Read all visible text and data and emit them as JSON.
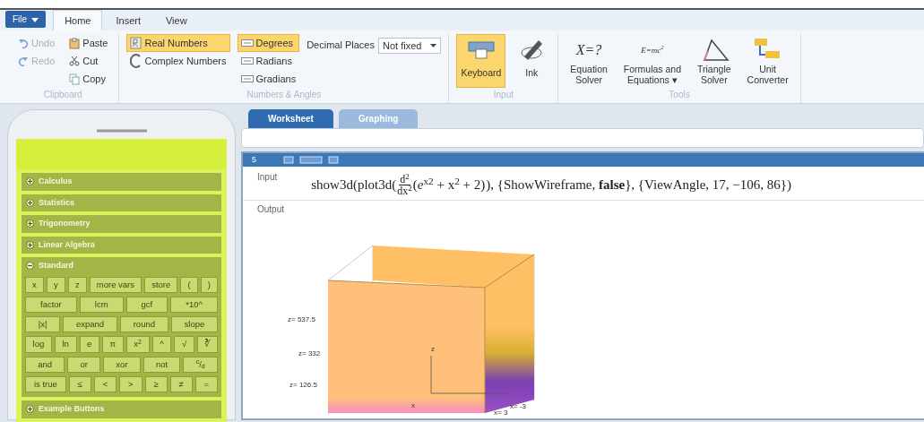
{
  "ribbon": {
    "file_button": "File",
    "tabs": [
      {
        "label": "Home",
        "selected": true
      },
      {
        "label": "Insert",
        "selected": false
      },
      {
        "label": "View",
        "selected": false
      }
    ],
    "groups": [
      {
        "kind": "clipboard",
        "label": "Clipboard",
        "items": [
          {
            "label": "Undo",
            "disabled": true
          },
          {
            "label": "Redo",
            "disabled": true
          },
          {
            "label": "Paste",
            "disabled": false
          },
          {
            "label": "Cut",
            "disabled": false
          },
          {
            "label": "Copy",
            "disabled": false
          }
        ]
      },
      {
        "kind": "numbers",
        "label": "Numbers & Angles",
        "number_modes": [
          {
            "label": "Real Numbers",
            "selected": true
          },
          {
            "label": "Complex Numbers",
            "selected": false
          }
        ],
        "angle_modes": [
          {
            "label": "Degrees",
            "selected": true
          },
          {
            "label": "Radians",
            "selected": false
          },
          {
            "label": "Gradians",
            "selected": false
          }
        ],
        "decimal_label": "Decimal Places",
        "decimal_value": "Not fixed"
      },
      {
        "kind": "input",
        "label": "Input",
        "items": [
          {
            "label": "Keyboard",
            "selected": true
          },
          {
            "label": "Ink",
            "selected": false
          }
        ]
      },
      {
        "kind": "tools",
        "label": "Tools",
        "items": [
          {
            "symbol": "X=?",
            "label": "Equation Solver"
          },
          {
            "symbol": "E=mc$^{2}$",
            "label": "Formulas and Equations ▾"
          },
          {
            "label": "Triangle Solver"
          },
          {
            "label": "Unit Converter"
          }
        ]
      }
    ]
  },
  "keypad": {
    "sections": [
      {
        "label": "Calculus",
        "expanded": false
      },
      {
        "label": "Statistics",
        "expanded": false
      },
      {
        "label": "Trigonometry",
        "expanded": false
      },
      {
        "label": "Linear Algebra",
        "expanded": false
      },
      {
        "label": "Standard",
        "expanded": true,
        "rows": [
          [
            "x",
            "y",
            "z",
            "more vars",
            "store",
            "(",
            ")"
          ],
          [
            "factor",
            "lcm",
            "gcf",
            "*10^"
          ],
          [
            "|x|",
            "expand",
            "round",
            "slope"
          ],
          [
            "log",
            "ln",
            "e",
            "π",
            "x$^{2}$",
            "^",
            "√",
            "∛"
          ],
          [
            "and",
            "or",
            "xor",
            "not",
            "$^{c}$/$_{d}$"
          ],
          [
            "is true",
            "≤",
            "<",
            ">",
            "≥",
            "≠",
            "="
          ]
        ]
      },
      {
        "label": "Example Buttons",
        "expanded": false
      }
    ]
  },
  "worksheet": {
    "tabs": [
      {
        "label": "Worksheet",
        "selected": true
      },
      {
        "label": "Graphing",
        "selected": false
      }
    ],
    "entry": {
      "number": "5",
      "input_label": "Input",
      "input": {
        "prefix": "show3d(plot3d(",
        "num": "d$^{2}$",
        "den": "dx$^{2}$",
        "body": "(*e*$^{x2}$ + x$^{2}$ + 2)",
        "suffix": "), {ShowWireframe, **false**}, {ViewAngle, 17, −106, 86})"
      },
      "output_label": "Output",
      "plot_labels": [
        {
          "kind": "tick",
          "text": "z= 537.5"
        },
        {
          "kind": "tick",
          "text": "z= 332"
        },
        {
          "kind": "tick",
          "text": "z= 126.5"
        },
        {
          "kind": "axis_z",
          "text": "z"
        },
        {
          "kind": "axis_x",
          "text": "x"
        },
        {
          "kind": "corner1",
          "text": "x= -3"
        },
        {
          "kind": "corner2",
          "text": "x= 3"
        }
      ]
    }
  }
}
